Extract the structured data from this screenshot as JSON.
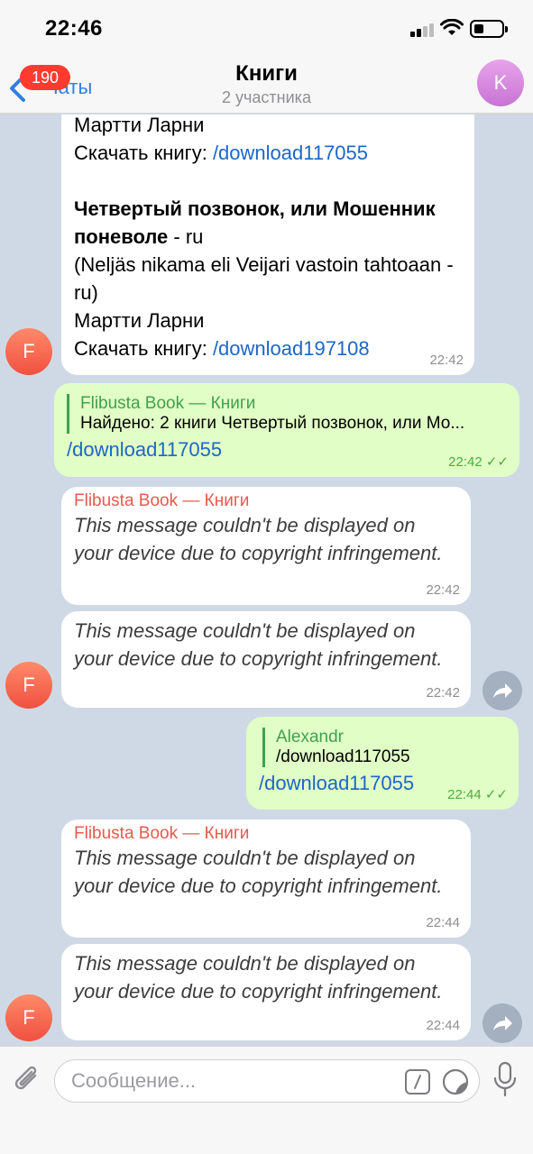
{
  "status": {
    "time": "22:46"
  },
  "nav": {
    "back_label": "Чаты",
    "badge": "190",
    "title": "Книги",
    "subtitle": "2 участника",
    "avatar_letter": "K"
  },
  "messages": {
    "m1": {
      "line1": "Мартти Ларни",
      "dl_prefix": "Скачать книгу: ",
      "dl_link": "/download117055",
      "title_bold": "Четвертый позвонок, или Мошенник поневоле",
      "title_lang": " - ru",
      "orig": "(Neljäs nikama eli Veijari vastoin tahtoaan - ru)",
      "author": "Мартти Ларни",
      "dl_prefix2": "Скачать книгу: ",
      "dl_link2": "/download197108",
      "time": "22:42"
    },
    "m2": {
      "reply_name": "Flibusta Book — Книги",
      "reply_text": "Найдено: 2 книги Четвертый позвонок, или Мо...",
      "link": "/download117055",
      "time": "22:42"
    },
    "m3": {
      "sender": "Flibusta Book — Книги",
      "text": "This message couldn't be displayed on your device due to copyright infringement.",
      "time": "22:42"
    },
    "m4": {
      "text": "This message couldn't be displayed on your device due to copyright infringement.",
      "time": "22:42"
    },
    "m5": {
      "reply_name": "Alexandr",
      "reply_text": "/download117055",
      "link": "/download117055",
      "time": "22:44"
    },
    "m6": {
      "sender": "Flibusta Book — Книги",
      "text": "This message couldn't be displayed on your device due to copyright infringement.",
      "time": "22:44"
    },
    "m7": {
      "text": "This message couldn't be displayed on your device due to copyright infringement.",
      "time": "22:44"
    },
    "avatar_letter": "F",
    "read_check": "✓✓"
  },
  "input": {
    "placeholder": "Сообщение..."
  },
  "colors": {
    "accent": "#2f7fe0",
    "badge": "#ff3b30",
    "outgoing_bubble": "#e1fec6",
    "incoming_sender": "#e55a4d",
    "reply_green": "#3fa24e"
  },
  "icons": [
    "back-chevron-icon",
    "signal-icon",
    "wifi-icon",
    "battery-icon",
    "share-icon",
    "paperclip-icon",
    "command-icon",
    "sticker-icon",
    "microphone-icon"
  ]
}
